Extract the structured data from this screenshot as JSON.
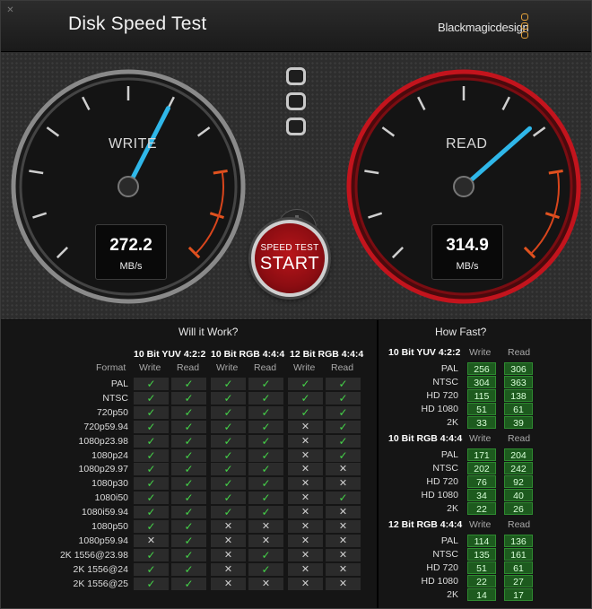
{
  "app": {
    "title": "Disk Speed Test",
    "brand": "Blackmagicdesign",
    "close_icon": "close-icon"
  },
  "write": {
    "label": "WRITE",
    "value": "272.2",
    "unit": "MB/s",
    "needle_fraction": 0.6
  },
  "read": {
    "label": "READ",
    "value": "314.9",
    "unit": "MB/s",
    "needle_fraction": 0.68
  },
  "start": {
    "line1": "SPEED TEST",
    "line2": "START"
  },
  "colors": {
    "accent_write": "#2fb7e9",
    "accent_read": "#c3141d",
    "ok": "#45d449",
    "bg": "#0d0d0d"
  },
  "will_it_work": {
    "title": "Will it Work?",
    "groups": [
      "10 Bit YUV 4:2:2",
      "10 Bit RGB 4:4:4",
      "12 Bit RGB 4:4:4"
    ],
    "format_header": "Format",
    "sub_labels": [
      "Write",
      "Read"
    ],
    "rows": [
      {
        "format": "PAL",
        "cells": [
          1,
          1,
          1,
          1,
          1,
          1
        ]
      },
      {
        "format": "NTSC",
        "cells": [
          1,
          1,
          1,
          1,
          1,
          1
        ]
      },
      {
        "format": "720p50",
        "cells": [
          1,
          1,
          1,
          1,
          1,
          1
        ]
      },
      {
        "format": "720p59.94",
        "cells": [
          1,
          1,
          1,
          1,
          0,
          1
        ]
      },
      {
        "format": "1080p23.98",
        "cells": [
          1,
          1,
          1,
          1,
          0,
          1
        ]
      },
      {
        "format": "1080p24",
        "cells": [
          1,
          1,
          1,
          1,
          0,
          1
        ]
      },
      {
        "format": "1080p29.97",
        "cells": [
          1,
          1,
          1,
          1,
          0,
          0
        ]
      },
      {
        "format": "1080p30",
        "cells": [
          1,
          1,
          1,
          1,
          0,
          0
        ]
      },
      {
        "format": "1080i50",
        "cells": [
          1,
          1,
          1,
          1,
          0,
          1
        ]
      },
      {
        "format": "1080i59.94",
        "cells": [
          1,
          1,
          1,
          1,
          0,
          0
        ]
      },
      {
        "format": "1080p50",
        "cells": [
          1,
          1,
          0,
          0,
          0,
          0
        ]
      },
      {
        "format": "1080p59.94",
        "cells": [
          0,
          1,
          0,
          0,
          0,
          0
        ]
      },
      {
        "format": "2K 1556@23.98",
        "cells": [
          1,
          1,
          0,
          1,
          0,
          0
        ]
      },
      {
        "format": "2K 1556@24",
        "cells": [
          1,
          1,
          0,
          1,
          0,
          0
        ]
      },
      {
        "format": "2K 1556@25",
        "cells": [
          1,
          1,
          0,
          0,
          0,
          0
        ]
      }
    ]
  },
  "how_fast": {
    "title": "How Fast?",
    "sub_labels": [
      "Write",
      "Read"
    ],
    "groups": [
      {
        "name": "10 Bit YUV 4:2:2",
        "rows": [
          {
            "label": "PAL",
            "write": "256",
            "read": "306"
          },
          {
            "label": "NTSC",
            "write": "304",
            "read": "363"
          },
          {
            "label": "HD 720",
            "write": "115",
            "read": "138"
          },
          {
            "label": "HD 1080",
            "write": "51",
            "read": "61"
          },
          {
            "label": "2K",
            "write": "33",
            "read": "39"
          }
        ]
      },
      {
        "name": "10 Bit RGB 4:4:4",
        "rows": [
          {
            "label": "PAL",
            "write": "171",
            "read": "204"
          },
          {
            "label": "NTSC",
            "write": "202",
            "read": "242"
          },
          {
            "label": "HD 720",
            "write": "76",
            "read": "92"
          },
          {
            "label": "HD 1080",
            "write": "34",
            "read": "40"
          },
          {
            "label": "2K",
            "write": "22",
            "read": "26"
          }
        ]
      },
      {
        "name": "12 Bit RGB 4:4:4",
        "rows": [
          {
            "label": "PAL",
            "write": "114",
            "read": "136"
          },
          {
            "label": "NTSC",
            "write": "135",
            "read": "161"
          },
          {
            "label": "HD 720",
            "write": "51",
            "read": "61"
          },
          {
            "label": "HD 1080",
            "write": "22",
            "read": "27"
          },
          {
            "label": "2K",
            "write": "14",
            "read": "17"
          }
        ]
      }
    ]
  }
}
